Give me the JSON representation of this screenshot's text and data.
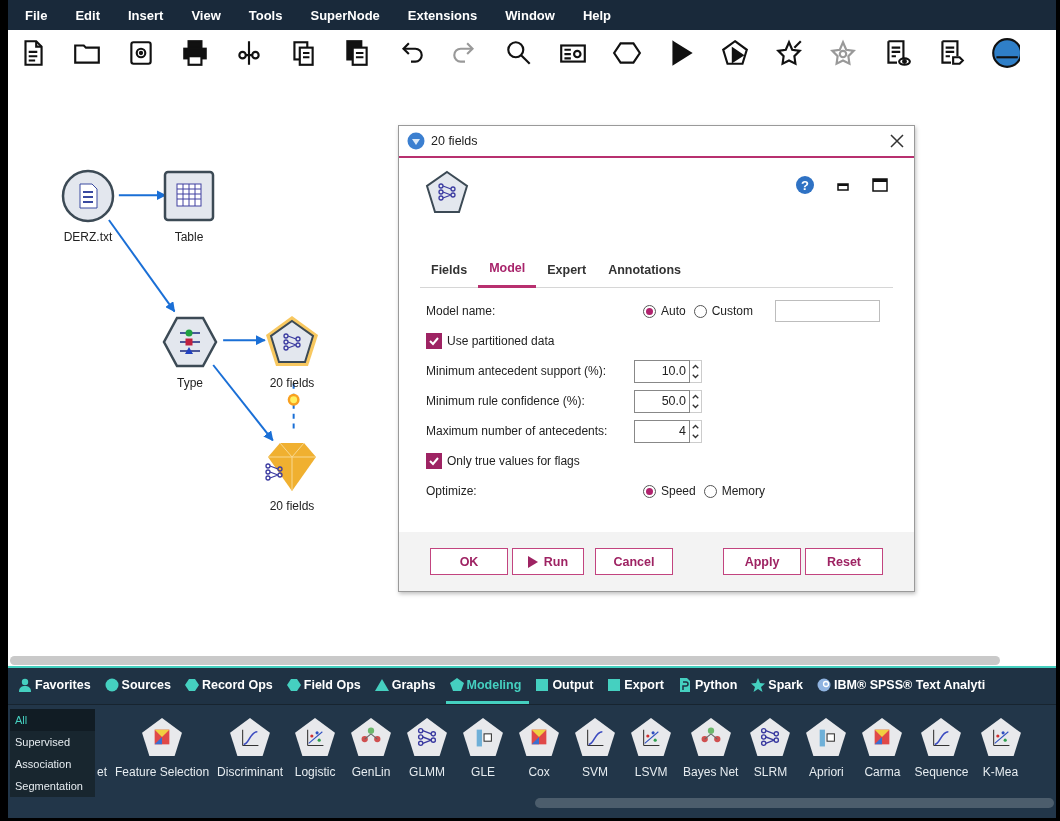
{
  "menu": [
    {
      "label": "File"
    },
    {
      "label": "Edit"
    },
    {
      "label": "Insert"
    },
    {
      "label": "View"
    },
    {
      "label": "Tools"
    },
    {
      "label": "SuperNode"
    },
    {
      "label": "Extensions"
    },
    {
      "label": "Window"
    },
    {
      "label": "Help"
    }
  ],
  "toolbar": [
    {
      "disabled": false
    },
    {
      "disabled": false
    },
    {
      "disabled": false
    },
    {
      "disabled": false
    },
    {
      "disabled": false
    },
    {
      "disabled": false
    },
    {
      "disabled": false
    },
    {
      "disabled": false
    },
    {
      "disabled": true
    },
    {
      "disabled": false
    },
    {
      "disabled": false
    },
    {
      "disabled": false
    },
    {
      "disabled": false
    },
    {
      "disabled": false
    },
    {
      "disabled": false
    },
    {
      "disabled": true
    },
    {
      "disabled": false
    },
    {
      "disabled": false
    },
    {
      "disabled": false
    }
  ],
  "canvas": {
    "nodes": [
      {
        "label": "DERZ.txt",
        "kind": "source",
        "selected": false
      },
      {
        "label": "Table",
        "kind": "output",
        "selected": false
      },
      {
        "label": "Type",
        "kind": "type",
        "selected": false
      },
      {
        "label": "20 fields",
        "kind": "modeling",
        "selected": true
      },
      {
        "label": "20 fields",
        "kind": "nugget",
        "selected": false
      }
    ]
  },
  "dialog": {
    "title": "20 fields",
    "help": "?",
    "tabs": [
      {
        "label": "Fields",
        "selected": false
      },
      {
        "label": "Model",
        "selected": true
      },
      {
        "label": "Expert",
        "selected": false
      },
      {
        "label": "Annotations",
        "selected": false
      }
    ],
    "rows": [
      {
        "kind": "radio",
        "label": "Model name:",
        "options": [
          {
            "label": "Auto",
            "selected": true
          },
          {
            "label": "Custom",
            "selected": false
          }
        ],
        "field": true
      },
      {
        "kind": "checkbox",
        "label": "Use partitioned data",
        "checked": true
      },
      {
        "kind": "spinner",
        "label": "Minimum antecedent support (%):",
        "value": "10.0"
      },
      {
        "kind": "spinner",
        "label": "Minimum rule confidence (%):",
        "value": "50.0"
      },
      {
        "kind": "spinner",
        "label": "Maximum number of antecedents:",
        "value": "4"
      },
      {
        "kind": "checkbox",
        "label": "Only true values for flags",
        "checked": true
      },
      {
        "kind": "radio",
        "label": "Optimize:",
        "options": [
          {
            "label": "Speed",
            "selected": true
          },
          {
            "label": "Memory",
            "selected": false
          }
        ]
      }
    ],
    "buttons": [
      {
        "label": "OK",
        "kind": "plain"
      },
      {
        "label": "Run",
        "kind": "run"
      },
      {
        "label": "Cancel",
        "kind": "plain"
      },
      {
        "label": "Apply",
        "kind": "right"
      },
      {
        "label": "Reset",
        "kind": "plain"
      }
    ]
  },
  "palette": {
    "tabs": [
      {
        "label": "Favorites",
        "selected": false
      },
      {
        "label": "Sources",
        "selected": false
      },
      {
        "label": "Record Ops",
        "selected": false
      },
      {
        "label": "Field Ops",
        "selected": false
      },
      {
        "label": "Graphs",
        "selected": false
      },
      {
        "label": "Modeling",
        "selected": true
      },
      {
        "label": "Output",
        "selected": false
      },
      {
        "label": "Export",
        "selected": false
      },
      {
        "label": "Python",
        "selected": false
      },
      {
        "label": "Spark",
        "selected": false
      },
      {
        "label": "IBM® SPSS® Text Analyti",
        "selected": false
      }
    ],
    "categories": [
      {
        "label": "All",
        "selected": true
      },
      {
        "label": "Supervised",
        "selected": false
      },
      {
        "label": "Association",
        "selected": false
      },
      {
        "label": "Segmentation",
        "selected": false
      }
    ],
    "nodes": [
      {
        "label": "et",
        "kind": "cut"
      },
      {
        "label": "Feature Selection",
        "kind": "node"
      },
      {
        "label": "Discriminant",
        "kind": "node"
      },
      {
        "label": "Logistic",
        "kind": "node"
      },
      {
        "label": "GenLin",
        "kind": "node"
      },
      {
        "label": "GLMM",
        "kind": "node"
      },
      {
        "label": "GLE",
        "kind": "node"
      },
      {
        "label": "Cox",
        "kind": "node"
      },
      {
        "label": "SVM",
        "kind": "node"
      },
      {
        "label": "LSVM",
        "kind": "node"
      },
      {
        "label": "Bayes Net",
        "kind": "node"
      },
      {
        "label": "SLRM",
        "kind": "node"
      },
      {
        "label": "Apriori",
        "kind": "node"
      },
      {
        "label": "Carma",
        "kind": "node"
      },
      {
        "label": "Sequence",
        "kind": "node"
      },
      {
        "label": "K-Mea",
        "kind": "node"
      }
    ]
  }
}
